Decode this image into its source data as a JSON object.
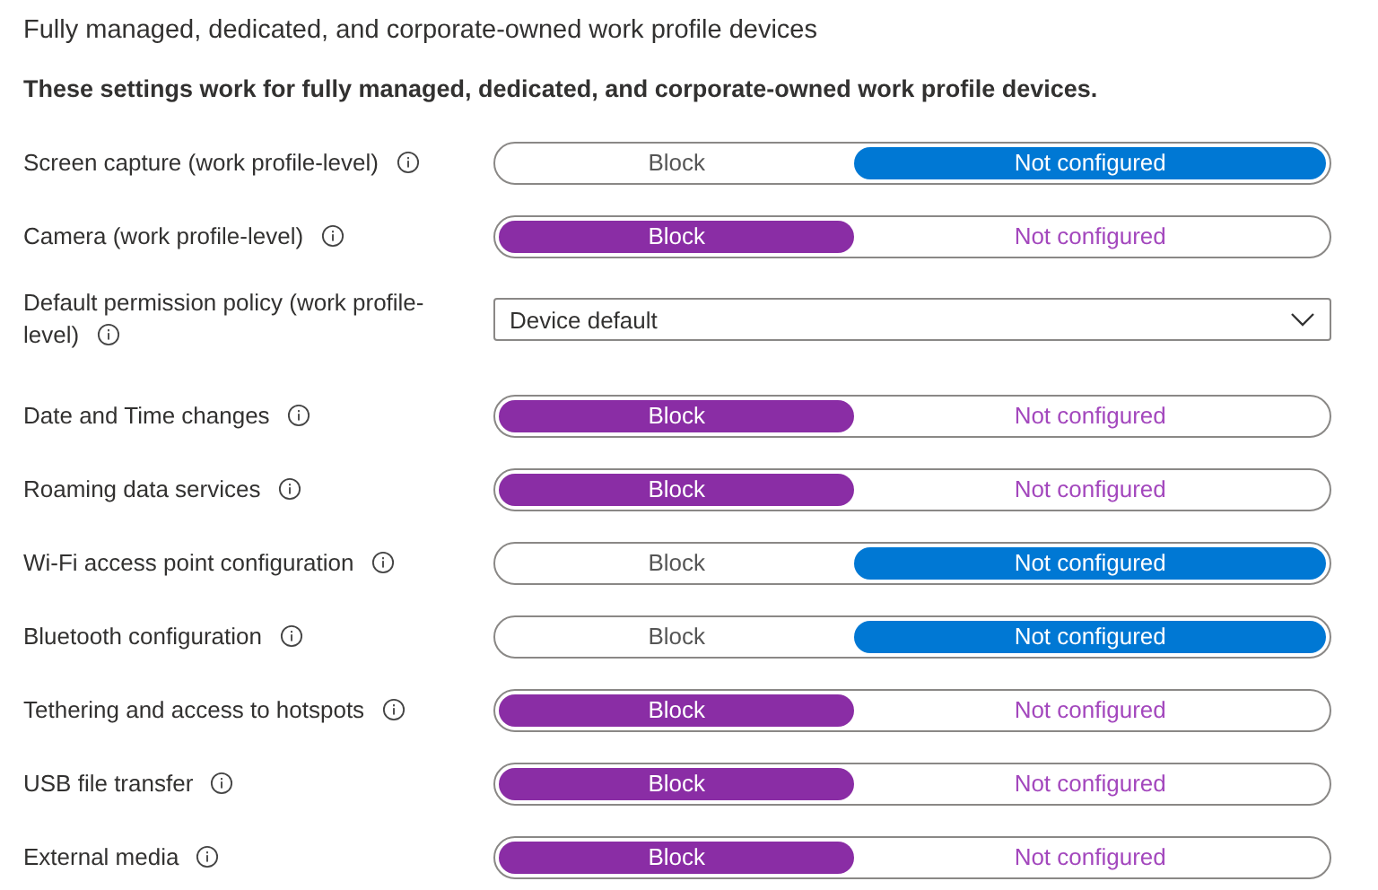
{
  "heading": "Fully managed, dedicated, and corporate-owned work profile devices",
  "description": "These settings work for fully managed, dedicated, and corporate-owned work profile devices.",
  "settings": [
    {
      "kind": "toggle",
      "label": "Screen capture (work profile-level)",
      "options": [
        {
          "label": "Block",
          "selected": false
        },
        {
          "label": "Not configured",
          "selected": true
        }
      ]
    },
    {
      "kind": "toggle",
      "label": "Camera (work profile-level)",
      "options": [
        {
          "label": "Block",
          "selected": true
        },
        {
          "label": "Not configured",
          "selected": false
        }
      ]
    },
    {
      "kind": "dropdown",
      "label": "Default permission policy (work profile-level)",
      "value": "Device default"
    },
    {
      "kind": "toggle",
      "label": "Date and Time changes",
      "options": [
        {
          "label": "Block",
          "selected": true
        },
        {
          "label": "Not configured",
          "selected": false
        }
      ]
    },
    {
      "kind": "toggle",
      "label": "Roaming data services",
      "options": [
        {
          "label": "Block",
          "selected": true
        },
        {
          "label": "Not configured",
          "selected": false
        }
      ]
    },
    {
      "kind": "toggle",
      "label": "Wi-Fi access point configuration",
      "options": [
        {
          "label": "Block",
          "selected": false
        },
        {
          "label": "Not configured",
          "selected": true
        }
      ]
    },
    {
      "kind": "toggle",
      "label": "Bluetooth configuration",
      "options": [
        {
          "label": "Block",
          "selected": false
        },
        {
          "label": "Not configured",
          "selected": true
        }
      ]
    },
    {
      "kind": "toggle",
      "label": "Tethering and access to hotspots",
      "options": [
        {
          "label": "Block",
          "selected": true
        },
        {
          "label": "Not configured",
          "selected": false
        }
      ]
    },
    {
      "kind": "toggle",
      "label": "USB file transfer",
      "options": [
        {
          "label": "Block",
          "selected": true
        },
        {
          "label": "Not configured",
          "selected": false
        }
      ]
    },
    {
      "kind": "toggle",
      "label": "External media",
      "options": [
        {
          "label": "Block",
          "selected": true
        },
        {
          "label": "Not configured",
          "selected": false
        }
      ]
    }
  ]
}
